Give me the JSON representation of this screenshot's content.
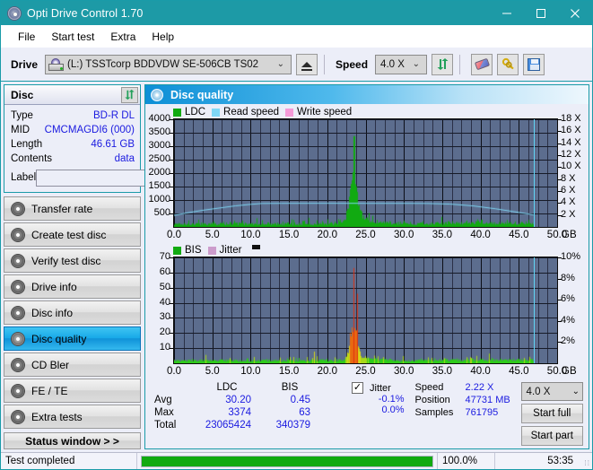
{
  "window": {
    "title": "Opti Drive Control 1.70",
    "icon": "disc-icon",
    "minimize": "─",
    "maximize": "☐",
    "close": "✕"
  },
  "menu": {
    "items": [
      "File",
      "Start test",
      "Extra",
      "Help"
    ]
  },
  "toolbar": {
    "drive_label": "Drive",
    "drive_value": "(L:)   TSSTcorp BDDVDW SE-506CB TS02",
    "eject_title": "eject-button",
    "speed_label": "Speed",
    "speed_value": "4.0 X",
    "caret": "⌄",
    "buttons": [
      "refresh-icon",
      "eraser-icon",
      "keys-icon",
      "save-icon"
    ]
  },
  "sidebar": {
    "disc_panel": {
      "title": "Disc",
      "refresh_glyph": "⇅",
      "rows": [
        {
          "key": "Type",
          "value": "BD-R DL"
        },
        {
          "key": "MID",
          "value": "CMCMAGDI6 (000)"
        },
        {
          "key": "Length",
          "value": "46.61 GB"
        },
        {
          "key": "Contents",
          "value": "data"
        }
      ],
      "label_key": "Label",
      "label_value": "",
      "label_placeholder": ""
    },
    "nav": [
      {
        "label": "Transfer rate",
        "active": false
      },
      {
        "label": "Create test disc",
        "active": false
      },
      {
        "label": "Verify test disc",
        "active": false
      },
      {
        "label": "Drive info",
        "active": false
      },
      {
        "label": "Disc info",
        "active": false
      },
      {
        "label": "Disc quality",
        "active": true
      },
      {
        "label": "CD Bler",
        "active": false
      },
      {
        "label": "FE / TE",
        "active": false
      },
      {
        "label": "Extra tests",
        "active": false
      }
    ],
    "status_window_button": "Status window > >"
  },
  "main": {
    "header_title": "Disc quality",
    "header_icon": "disc-quality-icon"
  },
  "stats": {
    "col_headers": [
      "LDC",
      "BIS"
    ],
    "rows": [
      {
        "label": "Avg",
        "ldc": "30.20",
        "bis": "0.45"
      },
      {
        "label": "Max",
        "ldc": "3374",
        "bis": "63"
      },
      {
        "label": "Total",
        "ldc": "23065424",
        "bis": "340379"
      }
    ],
    "jitter": {
      "checked": true,
      "check_glyph": "✓",
      "label": "Jitter",
      "avg": "-0.1%",
      "max": "0.0%"
    },
    "speed_key": "Speed",
    "speed_value": "2.22 X",
    "position_key": "Position",
    "position_value": "47731 MB",
    "samples_key": "Samples",
    "samples_value": "761795",
    "speed_select": "4.0 X",
    "caret": "⌄",
    "start_full": "Start full",
    "start_part": "Start part"
  },
  "statusbar": {
    "message": "Test completed",
    "progress_percent": "100.0%",
    "progress_value": 100,
    "elapsed": "53:35",
    "grip": "∶∶"
  },
  "colors": {
    "titlebar": "#1d9aa6",
    "accent_blue": "#1a1ae0",
    "plot_bg": "#5c6d8e",
    "ldc_green": "#22cc22",
    "read_speed": "#7fd8f5",
    "write_speed": "#f59ad8",
    "jitter_pink": "#cc9ccc",
    "progress_green": "#11aa11",
    "active_nav": "#17a9e8"
  },
  "chart_data": [
    {
      "id": "ldc-chart",
      "type": "area",
      "title": "",
      "legend": [
        {
          "label": "LDC",
          "color": "#11aa11"
        },
        {
          "label": "Read speed",
          "color": "#7fd8f5"
        },
        {
          "label": "Write speed",
          "color": "#f59ad8"
        }
      ],
      "legend_position": "top-left",
      "xlabel": "GB",
      "xlim": [
        0,
        50
      ],
      "xticks": [
        0.0,
        5.0,
        10.0,
        15.0,
        20.0,
        25.0,
        30.0,
        35.0,
        40.0,
        45.0,
        50.0
      ],
      "xticklabels": [
        "0.0",
        "5.0",
        "10.0",
        "15.0",
        "20.0",
        "25.0",
        "30.0",
        "35.0",
        "40.0",
        "45.0",
        "50.0"
      ],
      "ylabel_left": "LDC",
      "ylim_left": [
        0,
        4000
      ],
      "yticks_left": [
        500,
        1000,
        1500,
        2000,
        2500,
        3000,
        3500,
        4000
      ],
      "yticklabels_left": [
        "500",
        "1000",
        "1500",
        "2000",
        "2500",
        "3000",
        "3500",
        "4000"
      ],
      "ylabel_right": "Speed",
      "ylim_right": [
        0,
        18
      ],
      "yticks_right": [
        2,
        4,
        6,
        8,
        10,
        12,
        14,
        16,
        18
      ],
      "yticklabels_right": [
        "2 X",
        "4 X",
        "6 X",
        "8 X",
        "10 X",
        "12 X",
        "14 X",
        "16 X",
        "18 X"
      ],
      "grid": true,
      "marker_line_x": 46.9,
      "series": [
        {
          "name": "LDC",
          "color": "#11aa11",
          "kind": "impulse",
          "data_end_x": 46.9,
          "baseline": 120,
          "noise_amp": 130,
          "spike_x": 23.4,
          "spike_peak": 3374,
          "spike_decay": 1.6
        },
        {
          "name": "Read speed",
          "color": "#7fd8f5",
          "kind": "line",
          "points": [
            [
              0.0,
              2.0
            ],
            [
              2.0,
              2.5
            ],
            [
              4.0,
              2.9
            ],
            [
              6.0,
              3.25
            ],
            [
              8.0,
              3.6
            ],
            [
              10.0,
              3.85
            ],
            [
              11.5,
              4.0
            ],
            [
              14.0,
              4.02
            ],
            [
              20.0,
              4.03
            ],
            [
              25.0,
              4.02
            ],
            [
              30.0,
              4.02
            ],
            [
              33.0,
              4.0
            ],
            [
              36.0,
              3.9
            ],
            [
              39.0,
              3.6
            ],
            [
              42.0,
              3.1
            ],
            [
              45.0,
              2.5
            ],
            [
              46.9,
              2.1
            ]
          ]
        }
      ]
    },
    {
      "id": "bis-chart",
      "type": "area",
      "title": "",
      "legend": [
        {
          "label": "BIS",
          "color": "#11aa11"
        },
        {
          "label": "Jitter",
          "color": "#cc9ccc"
        }
      ],
      "legend_position": "top-left",
      "xlabel": "GB",
      "xlim": [
        0,
        50
      ],
      "xticks": [
        0.0,
        5.0,
        10.0,
        15.0,
        20.0,
        25.0,
        30.0,
        35.0,
        40.0,
        45.0,
        50.0
      ],
      "xticklabels": [
        "0.0",
        "5.0",
        "10.0",
        "15.0",
        "20.0",
        "25.0",
        "30.0",
        "35.0",
        "40.0",
        "45.0",
        "50.0"
      ],
      "ylabel_left": "BIS",
      "ylim_left": [
        0,
        70
      ],
      "yticks_left": [
        10,
        20,
        30,
        40,
        50,
        60,
        70
      ],
      "yticklabels_left": [
        "10",
        "20",
        "30",
        "40",
        "50",
        "60",
        "70"
      ],
      "ylabel_right": "Jitter",
      "ylim_right": [
        0,
        10
      ],
      "yticks_right": [
        2,
        4,
        6,
        8,
        10
      ],
      "yticklabels_right": [
        "2%",
        "4%",
        "6%",
        "8%",
        "10%"
      ],
      "grid": true,
      "marker_line_x": 46.9,
      "series": [
        {
          "name": "BIS",
          "color": "#11aa11",
          "kind": "impulse-graded",
          "data_end_x": 46.9,
          "baseline": 1.8,
          "noise_amp": 2.2,
          "spike_x": 23.4,
          "spike_peak": 63,
          "spike_decay": 1.1
        }
      ]
    }
  ]
}
